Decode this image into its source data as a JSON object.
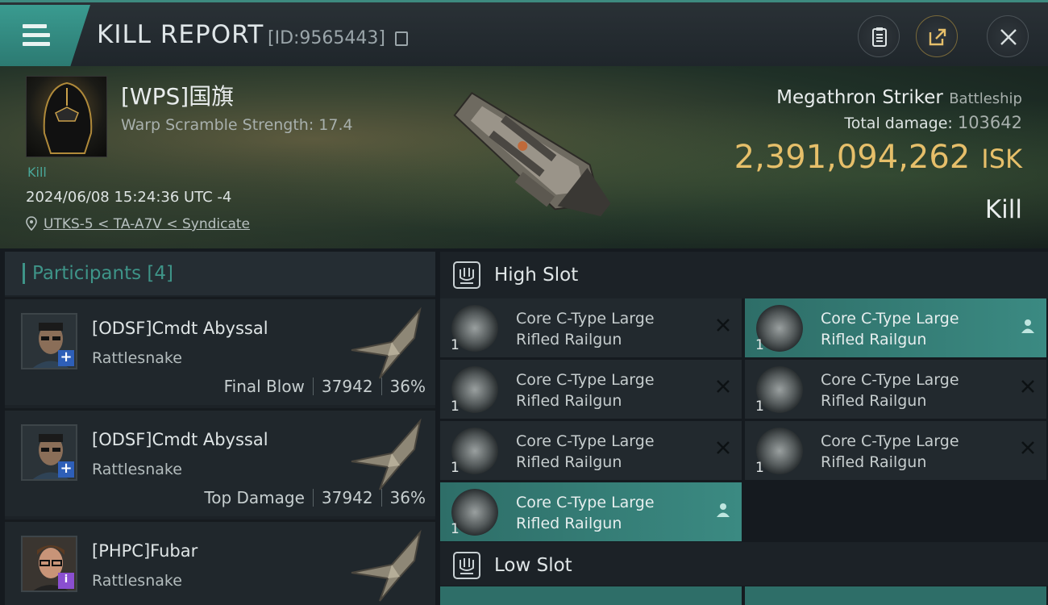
{
  "header": {
    "title": "KILL REPORT",
    "report_id": "[ID:9565443]"
  },
  "victim": {
    "pilot_name": "[WPS]国旗",
    "warp_scramble": "Warp Scramble Strength: 17.4",
    "kill_tag": "Kill",
    "datetime": "2024/06/08 15:24:36 UTC -4",
    "location": "UTKS-5 < TA-A7V < Syndicate",
    "ship_name": "Megathron Striker",
    "ship_class": "Battleship",
    "total_damage_label": "Total damage:",
    "total_damage_value": "103642",
    "isk_value": "2,391,094,262",
    "isk_unit": "ISK",
    "result": "Kill"
  },
  "participants": {
    "label": "Participants [4]",
    "rows": [
      {
        "name": "[ODSF]Cmdt Abyssal",
        "ship": "Rattlesnake",
        "role": "Final Blow",
        "damage": "37942",
        "percent": "36%"
      },
      {
        "name": "[ODSF]Cmdt Abyssal",
        "ship": "Rattlesnake",
        "role": "Top Damage",
        "damage": "37942",
        "percent": "36%"
      },
      {
        "name": "[PHPC]Fubar",
        "ship": "Rattlesnake"
      }
    ]
  },
  "high_slot": {
    "label": "High Slot",
    "modules": [
      {
        "line1": "Core C-Type Large",
        "line2": "Rifled Railgun",
        "qty": "1",
        "state": "destroyed",
        "highlight": false
      },
      {
        "line1": "Core C-Type Large",
        "line2": "Rifled Railgun",
        "qty": "1",
        "state": "dropped",
        "highlight": true
      },
      {
        "line1": "Core C-Type Large",
        "line2": "Rifled Railgun",
        "qty": "1",
        "state": "destroyed",
        "highlight": false
      },
      {
        "line1": "Core C-Type Large",
        "line2": "Rifled Railgun",
        "qty": "1",
        "state": "destroyed",
        "highlight": false
      },
      {
        "line1": "Core C-Type Large",
        "line2": "Rifled Railgun",
        "qty": "1",
        "state": "destroyed",
        "highlight": false
      },
      {
        "line1": "Core C-Type Large",
        "line2": "Rifled Railgun",
        "qty": "1",
        "state": "destroyed",
        "highlight": false
      },
      {
        "line1": "Core C-Type Large",
        "line2": "Rifled Railgun",
        "qty": "1",
        "state": "dropped",
        "highlight": true
      }
    ]
  },
  "low_slot": {
    "label": "Low Slot"
  },
  "colors": {
    "accent": "#3e9488",
    "isk": "#e6bf6a"
  }
}
